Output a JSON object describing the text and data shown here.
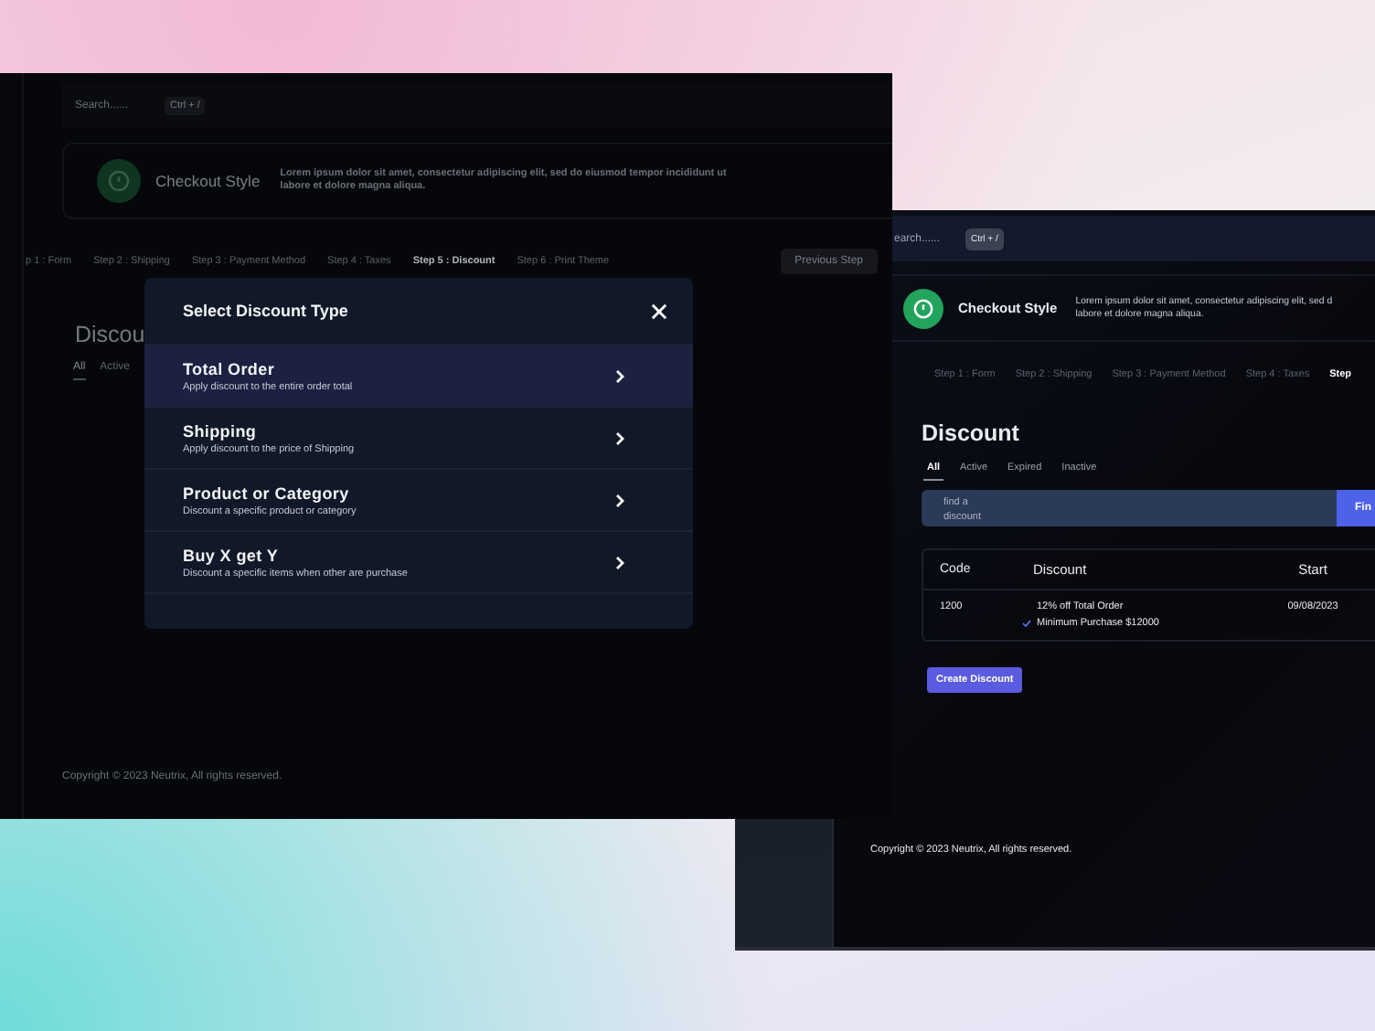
{
  "modal_screen": {
    "search": {
      "placeholder": "Search......"
    },
    "shortcut": "Ctrl + /",
    "banner": {
      "title": "Checkout Style",
      "text": "Lorem ipsum dolor sit amet, consectetur adipiscing elit, sed do eiusmod tempor incididunt ut\nlabore et dolore magna aliqua."
    },
    "steps": [
      {
        "label": "p 1 : Form",
        "selected": false
      },
      {
        "label": "Step 2 : Shipping",
        "selected": false
      },
      {
        "label": "Step 3 : Payment Method",
        "selected": false
      },
      {
        "label": "Step 4 : Taxes",
        "selected": false
      },
      {
        "label": "Step 5 : Discount",
        "selected": true
      },
      {
        "label": "Step 6 : Print Theme",
        "selected": false
      }
    ],
    "previous_button": "Previous Step",
    "page_title": "Discou",
    "tabs": [
      {
        "label": "All",
        "selected": true
      },
      {
        "label": "Active",
        "selected": false
      }
    ],
    "footer": "Copyright © 2023 Neutrix, All rights reserved."
  },
  "modal": {
    "title": "Select Discount Type",
    "options": [
      {
        "title": "Total Order",
        "description": "Apply discount to the entire order total",
        "selected": true
      },
      {
        "title": "Shipping",
        "description": "Apply discount to the price of Shipping",
        "selected": false
      },
      {
        "title": "Product or Category",
        "description": "Discount a specific product or category",
        "selected": false
      },
      {
        "title": "Buy X get Y",
        "description": "Discount a specific items when other are purchase",
        "selected": false
      }
    ]
  },
  "list_screen": {
    "search": {
      "placeholder": "earch......"
    },
    "shortcut": "Ctrl + /",
    "banner": {
      "title": "Checkout Style",
      "text": "Lorem ipsum dolor sit amet, consectetur adipiscing elit, sed d\nlabore et dolore magna aliqua."
    },
    "steps": [
      {
        "label": "Step 1 : Form",
        "selected": false
      },
      {
        "label": "Step 2 : Shipping",
        "selected": false
      },
      {
        "label": "Step 3 : Payment Method",
        "selected": false
      },
      {
        "label": "Step 4 : Taxes",
        "selected": false
      },
      {
        "label": "Step",
        "selected": true
      }
    ],
    "page_title": "Discount",
    "tabs": [
      {
        "label": "All",
        "selected": true
      },
      {
        "label": "Active",
        "selected": false
      },
      {
        "label": "Expired",
        "selected": false
      },
      {
        "label": "Inactive",
        "selected": false
      }
    ],
    "filter": {
      "placeholder": "find a discount",
      "button": "Fin"
    },
    "table": {
      "columns": [
        "Code",
        "Discount",
        "Start"
      ],
      "rows": [
        {
          "code": "1200",
          "discount": "12% off Total Order",
          "condition": "Minimum Purchase $12000",
          "start": "09/08/2023"
        }
      ]
    },
    "create_button": "Create Discount",
    "footer": "Copyright © 2023 Neutrix, All rights reserved."
  }
}
